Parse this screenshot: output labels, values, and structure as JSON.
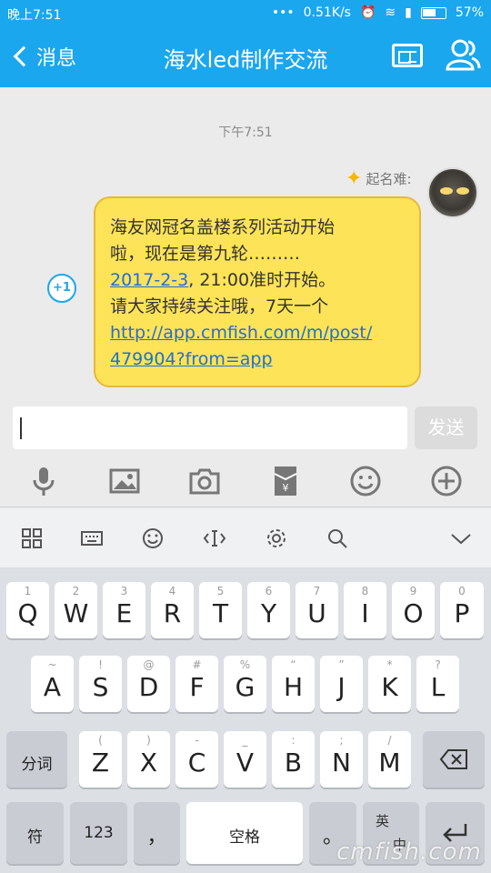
{
  "status_bar": {
    "time": "晚上7:51",
    "network_speed": "0.51K/s",
    "battery": "57%"
  },
  "header": {
    "back_label": "消息",
    "title": "海水led制作交流"
  },
  "chat": {
    "timestamp": "下午7:51",
    "message": {
      "sender": "起名难:",
      "lines": [
        "海友网冠名盖楼系列活动开始",
        "啦，现在是第九轮………",
        "2017-2-3",
        ", 21:00准时开始。",
        "请大家持续关注哦，7天一个",
        "http://app.cmfish.com/m/post/",
        "479904?from=app"
      ],
      "plus_one_label": "+1"
    }
  },
  "input_bar": {
    "value": "",
    "send_label": "发送"
  },
  "tools": [
    "microphone-icon",
    "image-icon",
    "camera-icon",
    "red-packet-icon",
    "emoji-icon",
    "plus-icon"
  ],
  "keyboard": {
    "row1": [
      {
        "main": "Q",
        "sub": "1"
      },
      {
        "main": "W",
        "sub": "2"
      },
      {
        "main": "E",
        "sub": "3"
      },
      {
        "main": "R",
        "sub": "4"
      },
      {
        "main": "T",
        "sub": "5"
      },
      {
        "main": "Y",
        "sub": "6"
      },
      {
        "main": "U",
        "sub": "7"
      },
      {
        "main": "I",
        "sub": "8"
      },
      {
        "main": "O",
        "sub": "9"
      },
      {
        "main": "P",
        "sub": "0"
      }
    ],
    "row2": [
      {
        "main": "A",
        "sub": "~"
      },
      {
        "main": "S",
        "sub": "!"
      },
      {
        "main": "D",
        "sub": "@"
      },
      {
        "main": "F",
        "sub": "#"
      },
      {
        "main": "G",
        "sub": "%"
      },
      {
        "main": "H",
        "sub": "“"
      },
      {
        "main": "J",
        "sub": "”"
      },
      {
        "main": "K",
        "sub": "*"
      },
      {
        "main": "L",
        "sub": "?"
      }
    ],
    "row3": [
      {
        "main": "Z",
        "sub": "("
      },
      {
        "main": "X",
        "sub": ")"
      },
      {
        "main": "C",
        "sub": "-"
      },
      {
        "main": "V",
        "sub": "_"
      },
      {
        "main": "B",
        "sub": ":"
      },
      {
        "main": "N",
        "sub": ";"
      },
      {
        "main": "M",
        "sub": "/"
      }
    ],
    "segment_label": "分词",
    "symbol_label": "符",
    "numbers_label": "123",
    "comma_label": "，",
    "space_label": "空格",
    "period_label": "。",
    "lang_top": "英",
    "lang_bottom": "中"
  },
  "watermark": "cmfish.com"
}
